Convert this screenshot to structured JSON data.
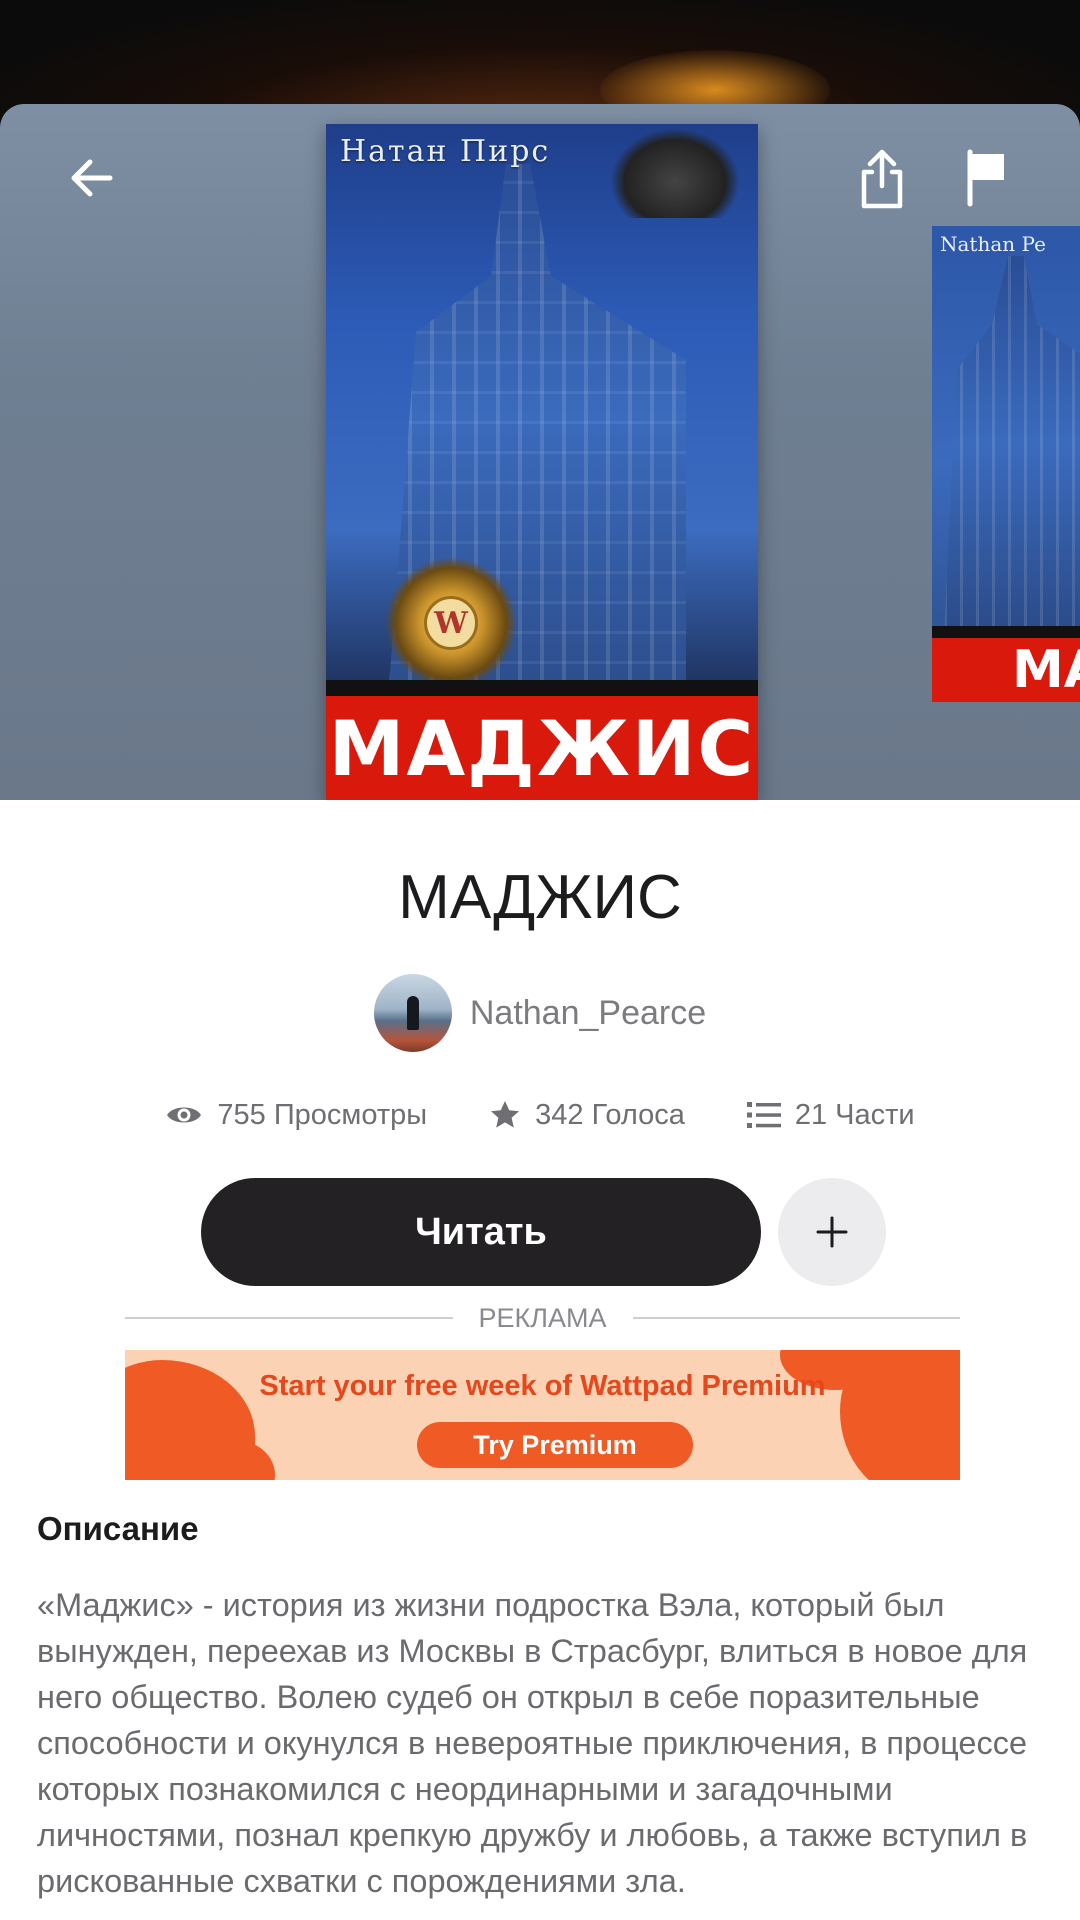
{
  "header": {
    "back_icon": "arrow-left-icon",
    "share_icon": "share-icon",
    "flag_icon": "flag-icon"
  },
  "cover": {
    "author_text": "Натан Пирс",
    "title_text": "МАДЖИС",
    "medal_letter": "W",
    "next_author_text": "Nathan Pe",
    "next_title_text": "МА"
  },
  "book": {
    "title": "МАДЖИС",
    "author": "Nathan_Pearce"
  },
  "stats": {
    "views": "755 Просмотры",
    "votes": "342 Голоса",
    "parts": "21 Части"
  },
  "actions": {
    "read_label": "Читать",
    "add_label": "+"
  },
  "ad": {
    "label": "РЕКЛАМА",
    "headline": "Start your free week of Wattpad Premium",
    "cta": "Try Premium",
    "colors": {
      "accent": "#f05a24",
      "background": "#fbd3b4"
    }
  },
  "description": {
    "heading": "Описание",
    "text": "«Маджис» - история из жизни подростка Вэла, который был вынужден, переехав из Москвы в Страсбург, влиться в новое для него общество. Волею судеб он открыл в себе поразительные способности и окунулся в невероятные приключения, в процессе которых познакомился с неординарными и загадочными личностями, познал крепкую дружбу и любовь, а также вступил в рискованные схватки с порождениями зла."
  }
}
